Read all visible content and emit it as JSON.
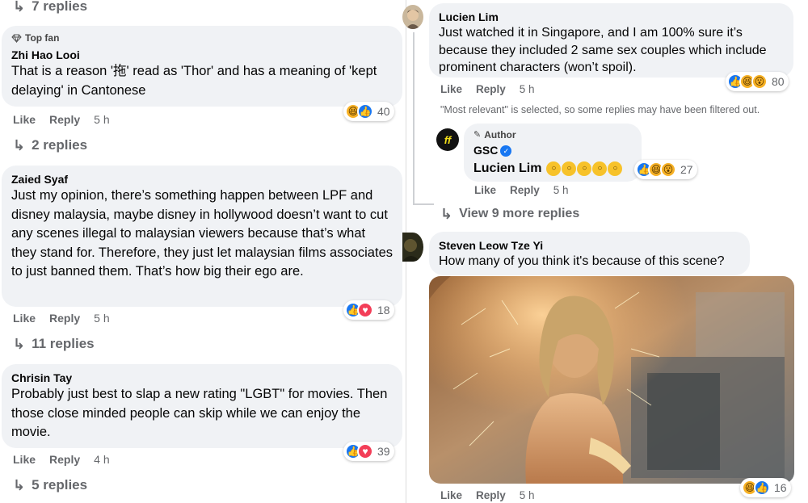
{
  "left": {
    "top_replies": "7 replies",
    "comments": [
      {
        "badge": "Top fan",
        "author": "Zhi Hao Looi",
        "text": "That is a reason '拖' read as 'Thor' and has a meaning of 'kept delaying' in Cantonese",
        "like": "Like",
        "reply": "Reply",
        "time": "5 h",
        "reactions": [
          "haha",
          "like"
        ],
        "count": "40",
        "replies": "2 replies"
      },
      {
        "author": "Zaied Syaf",
        "text": "Just my opinion, there’s something happen between LPF and disney malaysia, maybe disney in hollywood doesn’t want to cut any scenes illegal to malaysian viewers because that’s what they stand for. Therefore, they just let malaysian films associates to just banned them. That’s how big their ego are.",
        "like": "Like",
        "reply": "Reply",
        "time": "5 h",
        "reactions": [
          "like",
          "love"
        ],
        "count": "18",
        "replies": "11 replies"
      },
      {
        "author": "Chrisin Tay",
        "text": "Probably just best to slap a new rating \"LGBT\" for movies. Then those close minded people can skip while we can enjoy the movie.",
        "like": "Like",
        "reply": "Reply",
        "time": "4 h",
        "reactions": [
          "like",
          "love"
        ],
        "count": "39",
        "replies": "5 replies"
      }
    ]
  },
  "right": {
    "lucien": {
      "author": "Lucien Lim",
      "text": "Just watched it in Singapore, and I am 100% sure it’s because they included 2 same sex couples which include prominent characters (won’t spoil).",
      "like": "Like",
      "reply": "Reply",
      "time": "5 h",
      "reactions": [
        "like",
        "haha",
        "wow"
      ],
      "count": "80"
    },
    "filter_note": "\"Most relevant\" is selected, so some replies may have been filtered out.",
    "gsc": {
      "badge": "Author",
      "author": "GSC",
      "avatar_text": "GSC",
      "mention": "Lucien Lim",
      "like": "Like",
      "reply": "Reply",
      "time": "5 h",
      "reactions": [
        "like",
        "haha",
        "wow"
      ],
      "count": "27"
    },
    "view_more": "View 9 more replies",
    "steven": {
      "author": "Steven Leow Tze Yi",
      "text": "How many of you think it's because of this scene?",
      "like": "Like",
      "reply": "Reply",
      "time": "5 h",
      "reactions": [
        "haha",
        "like"
      ],
      "count": "16"
    }
  },
  "colors": {
    "bubble": "#f0f2f5",
    "meta": "#65676b",
    "like": "#1877f2",
    "love": "#f33e58",
    "haha": "#f7b125"
  }
}
